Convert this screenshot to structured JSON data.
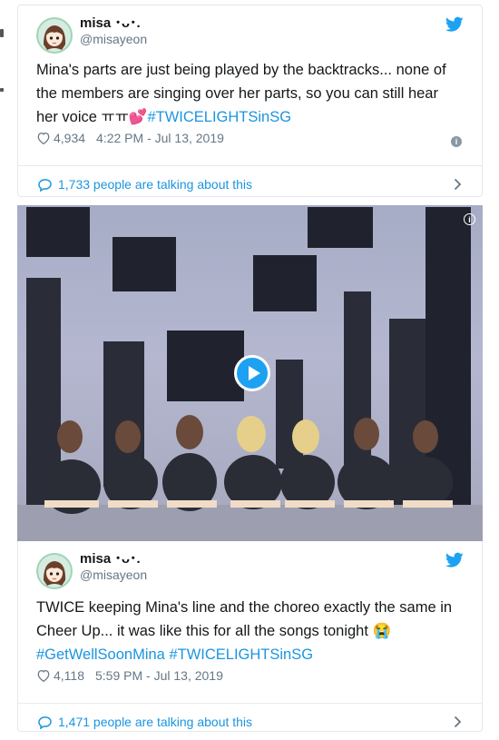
{
  "tweets": [
    {
      "name": "misa ･ᴗ･.",
      "handle": "@misayeon",
      "text": "Mina's parts are just being played by the backtracks... none of the members are singing over her parts, so you can still hear her voice ㅠㅠ",
      "emoji": "💕",
      "hashtags": "#TWICELIGHTSinSG",
      "likes": "4,934",
      "timestamp": "4:22 PM - Jul 13, 2019",
      "talking": "1,733 people are talking about this"
    },
    {
      "name": "misa ･ᴗ･.",
      "handle": "@misayeon",
      "text": "TWICE keeping Mina's line and the choreo exactly the same in Cheer Up... it was like this for all the songs tonight",
      "emoji": "😭",
      "hashtags": "#GetWellSoonMina #TWICELIGHTSinSG",
      "likes": "4,118",
      "timestamp": "5:59 PM - Jul 13, 2019",
      "talking": "1,471 people are talking about this"
    }
  ],
  "icons": {
    "bird": "twitter-bird-icon",
    "heart": "heart-icon",
    "info": "info-icon",
    "bubble": "speech-bubble-icon",
    "chevron": "chevron-right-icon",
    "play": "play-icon"
  },
  "colors": {
    "accent": "#1da1f2",
    "link": "#1b95e0",
    "muted": "#657786",
    "border": "#e1e8ed"
  }
}
